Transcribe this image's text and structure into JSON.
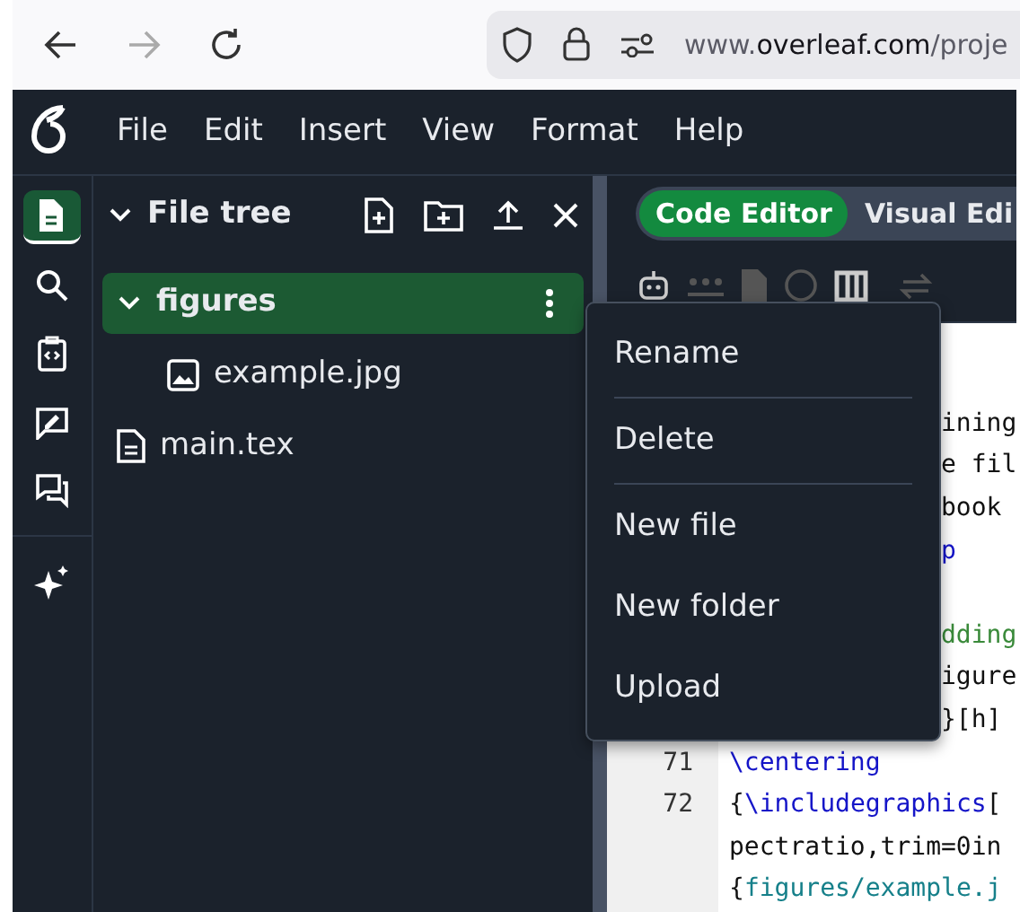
{
  "browser": {
    "url": {
      "prefix": "www.",
      "domain": "overleaf.com",
      "path": "/proje"
    }
  },
  "menubar": [
    "File",
    "Edit",
    "Insert",
    "View",
    "Format",
    "Help"
  ],
  "rail": [
    {
      "selected": true
    },
    {
      "selected": false
    },
    {
      "selected": false
    },
    {
      "selected": false
    },
    {
      "selected": false
    },
    {
      "selected": false
    }
  ],
  "file_tree": {
    "title": "File tree",
    "expanded": true,
    "items": [
      {
        "kind": "folder",
        "label": "figures",
        "selected": true,
        "expanded": true,
        "children": [
          {
            "kind": "image",
            "label": "example.jpg",
            "selected": false
          }
        ]
      },
      {
        "kind": "file",
        "label": "main.tex",
        "selected": false
      }
    ]
  },
  "context_menu": {
    "groups": [
      [
        "Rename"
      ],
      [
        "Delete"
      ],
      [
        "New file",
        "New folder",
        "Upload"
      ]
    ]
  },
  "editor": {
    "tabs": [
      {
        "label": "Code Editor",
        "selected": true
      },
      {
        "label": "Visual Edi",
        "selected": false
      }
    ],
    "lines": [
      {
        "kind": "partial",
        "tokens": [
          {
            "kind": "text",
            "text": "ining"
          }
        ]
      },
      {
        "kind": "partial",
        "tokens": [
          {
            "kind": "text",
            "text": "e fil"
          }
        ]
      },
      {
        "kind": "partial",
        "tokens": [
          {
            "kind": "text",
            "text": "book"
          }
        ]
      },
      {
        "kind": "partial",
        "tokens": [
          {
            "kind": "command",
            "text": "p"
          }
        ]
      },
      {
        "kind": "blank"
      },
      {
        "kind": "partial",
        "tokens": [
          {
            "kind": "comment",
            "text": "dding"
          }
        ]
      },
      {
        "kind": "partial",
        "tokens": [
          {
            "kind": "text",
            "text": "igure"
          }
        ]
      },
      {
        "kind": "partial",
        "tokens": [
          {
            "kind": "text",
            "text": "}[h]"
          }
        ]
      },
      {
        "kind": "numbered",
        "number": "71",
        "tokens": [
          {
            "kind": "command",
            "text": "\\centering"
          }
        ]
      },
      {
        "kind": "numbered",
        "number": "72",
        "tokens": [
          {
            "kind": "text",
            "text": "{"
          },
          {
            "kind": "command",
            "text": "\\includegraphics"
          },
          {
            "kind": "text",
            "text": "["
          }
        ]
      },
      {
        "kind": "wrap",
        "tokens": [
          {
            "kind": "text",
            "text": "pectratio,trim=0in"
          }
        ]
      },
      {
        "kind": "wrap",
        "tokens": [
          {
            "kind": "text",
            "text": "{"
          },
          {
            "kind": "path",
            "text": "figures/example.j"
          }
        ]
      }
    ]
  }
}
